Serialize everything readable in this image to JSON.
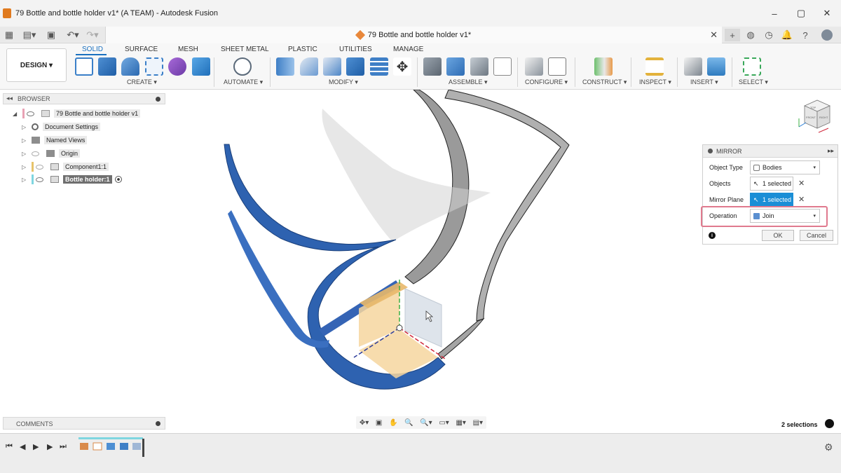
{
  "window": {
    "title": "79 Bottle and bottle holder v1* (A TEAM) - Autodesk Fusion",
    "minimize": "–",
    "maximize": "▢",
    "close": "✕"
  },
  "tabstrip": {
    "doc_tab_title": "79 Bottle and bottle holder v1*",
    "doc_tab_close": "✕",
    "new_tab": "+"
  },
  "ribbon": {
    "workspace": "DESIGN ▾",
    "tabs": [
      "SOLID",
      "SURFACE",
      "MESH",
      "SHEET METAL",
      "PLASTIC",
      "UTILITIES",
      "MANAGE"
    ],
    "active_tab": "SOLID",
    "groups": {
      "create": "CREATE ▾",
      "automate": "AUTOMATE ▾",
      "modify": "MODIFY ▾",
      "assemble": "ASSEMBLE ▾",
      "configure": "CONFIGURE ▾",
      "construct": "CONSTRUCT ▾",
      "inspect": "INSPECT ▾",
      "insert": "INSERT ▾",
      "select": "SELECT ▾"
    },
    "accent": "#1a70c0"
  },
  "browser": {
    "header": "BROWSER",
    "collapse": "◂◂",
    "items": [
      {
        "label": "79 Bottle and bottle holder v1",
        "arrow": "◢"
      },
      {
        "label": "Document Settings",
        "arrow": "▷"
      },
      {
        "label": "Named Views",
        "arrow": "▷"
      },
      {
        "label": "Origin",
        "arrow": "▷"
      },
      {
        "label": "Component1:1",
        "arrow": "▷"
      },
      {
        "label": "Bottle holder:1",
        "arrow": "▷"
      }
    ]
  },
  "mirror": {
    "header": "MIRROR",
    "expand": "▸▸",
    "object_type_label": "Object Type",
    "object_type_value": "Bodies",
    "objects_label": "Objects",
    "objects_value": "1 selected",
    "mirror_plane_label": "Mirror Plane",
    "mirror_plane_value": "1 selected",
    "operation_label": "Operation",
    "operation_value": "Join",
    "ok": "OK",
    "cancel": "Cancel",
    "info": "i",
    "clear": "✕",
    "dropdown": "▾"
  },
  "comments": {
    "header": "COMMENTS"
  },
  "navbar": {
    "icons": [
      "✥▾",
      "▣",
      "✋",
      "🔍",
      "🔍▾",
      "▭▾",
      "▦▾",
      "▤▾"
    ]
  },
  "status": {
    "selections": "2 selections"
  },
  "timeline": {
    "first": "⏮",
    "prev": "◀",
    "play": "▶",
    "next": "▶",
    "last": "⏭",
    "settings": "⚙"
  },
  "viewcube": {
    "faces": [
      "TOP",
      "FRONT",
      "RIGHT"
    ]
  }
}
